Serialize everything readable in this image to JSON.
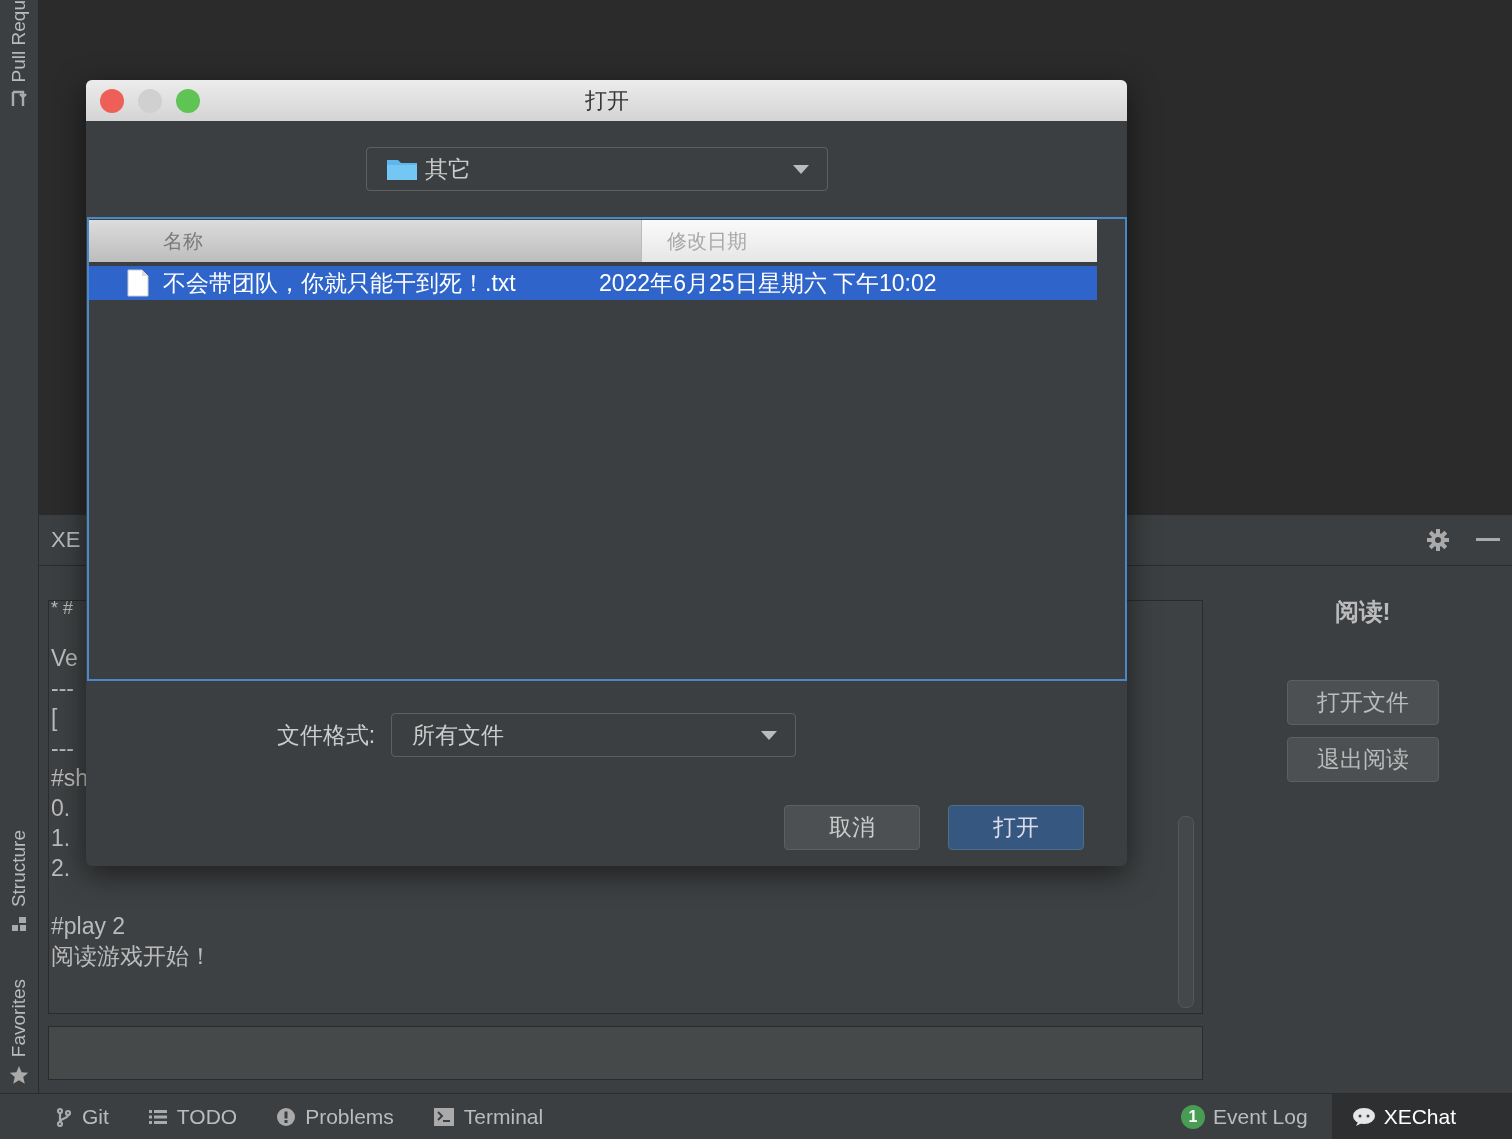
{
  "left_stripe": {
    "tools": [
      {
        "label": "Pull Requ"
      },
      {
        "label": "Structure"
      },
      {
        "label": "Favorites"
      }
    ]
  },
  "tool_window": {
    "title": "XE",
    "editor_blocks": [
      [
        "* #"
      ],
      [
        "Ve",
        "---",
        "[",
        "---",
        "#sh",
        "0.",
        "1.",
        "2."
      ],
      [
        "#play 2",
        "阅读游戏开始！"
      ]
    ],
    "heading": "阅读!",
    "buttons": [
      "打开文件",
      "退出阅读"
    ]
  },
  "dialog": {
    "title": "打开",
    "location": "其它",
    "columns": [
      {
        "label": "名称",
        "sorted": true
      },
      {
        "label": "修改日期",
        "sorted": false
      }
    ],
    "files": [
      {
        "name": "不会带团队，你就只能干到死！.txt",
        "modified": "2022年6月25日星期六 下午10:02",
        "selected": true
      }
    ],
    "format_label": "文件格式:",
    "format": "所有文件",
    "buttons": [
      {
        "label": "取消",
        "default": false
      },
      {
        "label": "打开",
        "default": true
      }
    ]
  },
  "bottom_bar": {
    "left": [
      {
        "label": "Git"
      },
      {
        "label": "TODO"
      },
      {
        "label": "Problems"
      },
      {
        "label": "Terminal"
      }
    ],
    "right": [
      {
        "label": "Event Log",
        "badge": "1",
        "selected": false
      },
      {
        "label": "XEChat",
        "selected": true
      }
    ]
  }
}
